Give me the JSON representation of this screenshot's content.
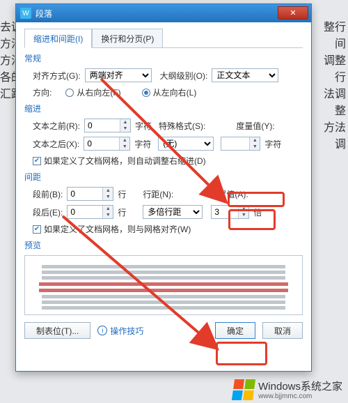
{
  "dialog": {
    "title": "段落",
    "close": "✕",
    "tabs": {
      "indent": "缩进和间距(I)",
      "pagination": "换行和分页(P)"
    },
    "general": {
      "title": "常规",
      "align_label": "对齐方式(G):",
      "align_value": "两端对齐",
      "outline_label": "大纲级别(O):",
      "outline_value": "正文文本",
      "direction_label": "方向:",
      "rtl": "从右向左(F)",
      "ltr": "从左向右(L)"
    },
    "indent": {
      "title": "缩进",
      "before_label": "文本之前(R):",
      "before_value": "0",
      "before_unit": "字符",
      "special_label": "特殊格式(S):",
      "special_value": "(无)",
      "measure_label": "度量值(Y):",
      "measure_value": "",
      "measure_unit": "字符",
      "after_label": "文本之后(X):",
      "after_value": "0",
      "after_unit": "字符",
      "grid_check": "如果定义了文档网格，则自动调整右缩进(D)"
    },
    "spacing": {
      "title": "间距",
      "before_label": "段前(B):",
      "before_value": "0",
      "before_unit": "行",
      "linespacing_label": "行距(N):",
      "linespacing_value": "多倍行距",
      "setvalue_label": "设置值(A):",
      "setvalue_value": "3",
      "setvalue_unit": "倍",
      "after_label": "段后(E):",
      "after_value": "0",
      "after_unit": "行",
      "grid_check": "如果定义了文档网格，则与网格对齐(W)"
    },
    "preview": {
      "title": "预览"
    },
    "footer": {
      "tabstops": "制表位(T)...",
      "tips": "操作技巧",
      "ok": "确定",
      "cancel": "取消"
    }
  },
  "bg": {
    "left": [
      "去调",
      "方法",
      "方法",
      "各的",
      "汇距"
    ],
    "right": [
      "整行间",
      "调整行",
      "法调整",
      "方法调"
    ]
  },
  "watermark": {
    "main": "Windows系统之家",
    "sub": "www.bjjmmc.com"
  }
}
